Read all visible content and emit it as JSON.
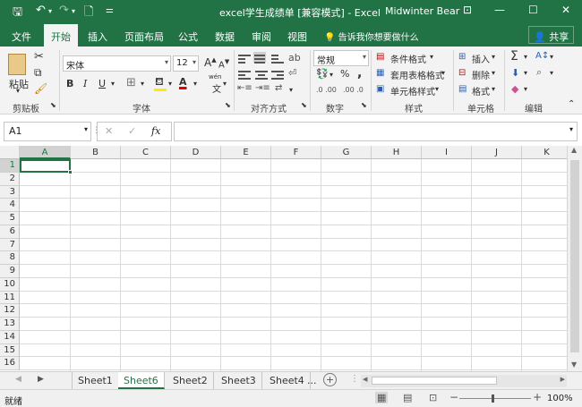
{
  "window": {
    "title": "excel学生成绩单  [兼容模式]  -  Excel",
    "user": "Midwinter Bear"
  },
  "tabs": [
    "文件",
    "开始",
    "插入",
    "页面布局",
    "公式",
    "数据",
    "审阅",
    "视图"
  ],
  "active_tab": "开始",
  "tell_me": "告诉我你想要做什么",
  "share": "共享",
  "ribbon": {
    "clipboard": {
      "paste": "粘贴",
      "label": "剪贴板"
    },
    "font": {
      "name": "宋体",
      "size": "12",
      "bold": "B",
      "italic": "I",
      "underline": "U",
      "label": "字体",
      "wen": "wén"
    },
    "align": {
      "label": "对齐方式"
    },
    "number": {
      "format": "常规",
      "percent": "%",
      "comma": ",",
      "label": "数字"
    },
    "styles": {
      "conditional": "条件格式",
      "table": "套用表格格式",
      "cell": "单元格样式",
      "label": "样式"
    },
    "cells": {
      "insert": "插入",
      "delete": "删除",
      "format": "格式",
      "label": "单元格"
    },
    "editing": {
      "label": "编辑"
    }
  },
  "formula_bar": {
    "name_box": "A1",
    "fx": "fx",
    "value": ""
  },
  "columns": [
    "A",
    "B",
    "C",
    "D",
    "E",
    "F",
    "G",
    "H",
    "I",
    "J",
    "K"
  ],
  "rows": [
    "1",
    "2",
    "3",
    "4",
    "5",
    "6",
    "7",
    "8",
    "9",
    "10",
    "11",
    "12",
    "13",
    "14",
    "15",
    "16"
  ],
  "selected_cell": "A1",
  "sheets": [
    "Sheet1",
    "Sheet6",
    "Sheet2",
    "Sheet3",
    "Sheet4"
  ],
  "active_sheet": "Sheet6",
  "more_sheets": "...",
  "status": {
    "ready": "就绪",
    "zoom": "100%"
  },
  "colors": {
    "brand": "#217346",
    "fill_yellow": "#ffeb00",
    "font_red": "#e00000"
  }
}
